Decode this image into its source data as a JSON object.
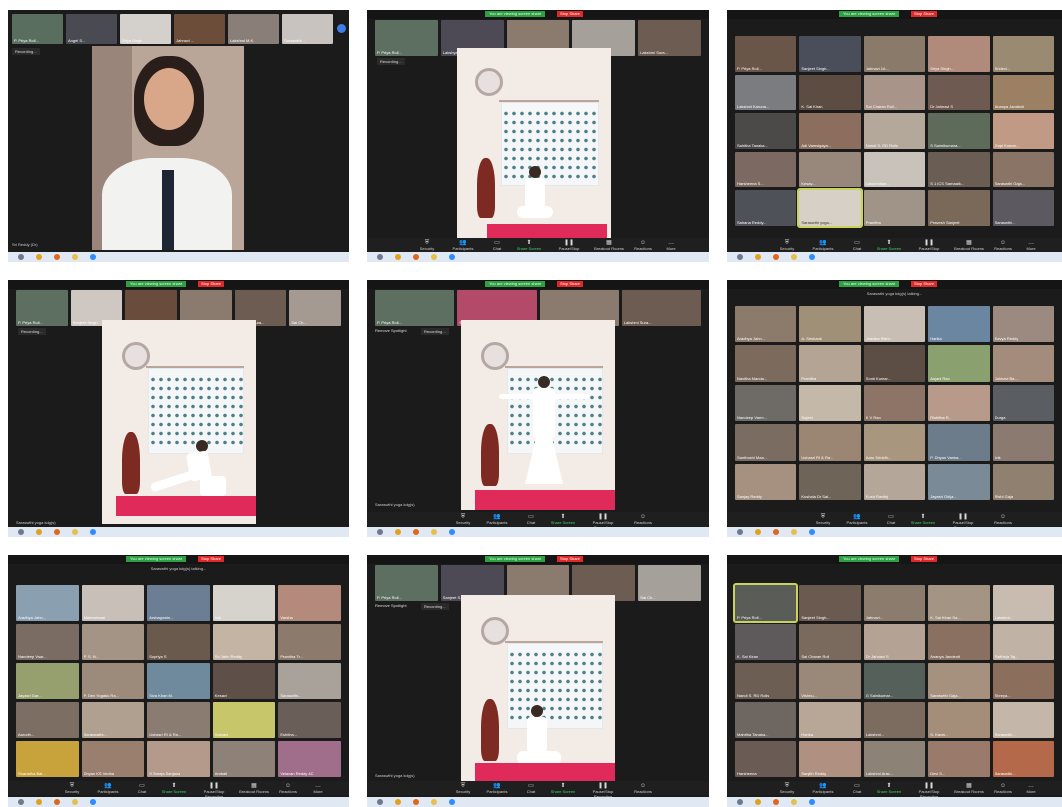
{
  "sharebar": {
    "notice": "You are viewing screen share",
    "stop_label": "Stop Share"
  },
  "recording_label": "Recording...",
  "remove_spotlight_label": "Remove Spotlight",
  "speaker_label": "Saraswthi yoga kdg(s)",
  "talking_label": "Saraswthi yoga kdg(s) talking...",
  "toolbar": {
    "security": "Security",
    "participants": "Participants",
    "chat": "Chat",
    "share_screen": "Share Screen",
    "record": "Pause/Stop Recording",
    "breakout": "Breakout Rooms",
    "reactions": "Reactions",
    "more": "More"
  },
  "p1": {
    "strip_names": [
      "P. Priya Roll...",
      "Angel S...",
      "Sriya Singh",
      "Jahnavi ...",
      "Lakshmi M.K.",
      "Saraswthi ..."
    ],
    "bottom_name": "Sri Reddy (Dr)"
  },
  "p2": {
    "strip_names": [
      "P. Priya Roll...",
      "Lakshya",
      "Jahnavi G...",
      "Sriya Sura...",
      "Lakshmi Sura..."
    ]
  },
  "p3": {
    "tiles": [
      "P. Priya Roll...",
      "Sanjeet Singh...",
      "Jahnavi 1A...",
      "Sriya Singh...",
      "Sridevi...",
      "Lakshmi Karuna...",
      "K. Sai Kiran",
      "Sai Charan Roll...",
      "Dr Jahnavi S",
      "Ananya Jandeoti",
      "Sahitha Tanaka...",
      "Adi Vamsigaya...",
      "Nandi S. RD Rolls",
      "S Saimikumara...",
      "Gopi Kumar...",
      "Harsheena S...",
      "Kesav...",
      "Lakshmikar...",
      "S 1 ICS Sarnaaik...",
      "Saraswthi Gaja...",
      "Sahana Reddy...",
      "Saraswthi yoga...",
      "Pranitha",
      "Pravesh Sanjeet",
      "Saraswthi..."
    ]
  },
  "p4": {
    "strip_names": [
      "P. Priya Roll...",
      "Sanjeet Singh",
      "Jahnavi",
      "Sai Ranjani Dy...",
      "Lakshmi Sura...",
      "Sai Ch..."
    ]
  },
  "p5": {
    "strip_names": [
      "P. Priya Roll...",
      "Sanjeet...",
      "Jahnavi GR...",
      "Lakshmi Sura..."
    ]
  },
  "p6": {
    "tiles": [
      "Aradhya Jahn...",
      "A. Seshank",
      "Jnanika Rishi...",
      "Harika",
      "Kavya Reddy",
      "Navitha Manda...",
      "Pranitha",
      "Sonti Kumar...",
      "Anjani Rao",
      "Jahnavi Ba...",
      "Nandeep Varm...",
      "Sujeet",
      "K V Rao",
      "Rishitha R..",
      "Durga",
      "Santhoshi Maa...",
      "Ushasri RI & Ra...",
      "Aaru Srinidh...",
      "P. Dhyan Vanka...",
      "Ivik",
      "Sanjay Reddy",
      "Kushala Dr Sai...",
      "Kush Ravitej",
      "Jayasri Girija...",
      "Rishi Gaja"
    ]
  },
  "p7": {
    "tiles": [
      "Aradhya Jahn...",
      "Maheshwari",
      "Arshagowin...",
      "Ivik",
      "Varsha",
      "Nandeep Vsar...",
      "P. S. N...",
      "Supriya S",
      "Sri Jahn Reddy",
      "Pranitha Tr...",
      "Jayasri Gar...",
      "P. Dev Yogaku Ra...",
      "Siva Kiran M.",
      "Kesavi",
      "Saraswthi...",
      "Aarudh...",
      "Saraswathi...",
      "Ushasri RI & Ra...",
      "Sarvani",
      "Eshitha...",
      "Sharadha Bal...",
      "Dhyan KS Vedha",
      "S Sreeja Sanjana",
      "Ambati",
      "Velavan Reddy 4C"
    ]
  },
  "p8": {
    "strip_names": [
      "P. Priya Roll...",
      "Sanjeet S...",
      "Jahnavi ...",
      "Lakshmi Surya...",
      "Sai Ch..."
    ]
  },
  "p9": {
    "tiles": [
      "P. Priya Roll...",
      "Sanjeet Singh...",
      "Jahnavi...",
      "K. Sai Kiran Sa...",
      "Lakshmi...",
      "K. Sai Kiran",
      "Sai Charan Roll",
      "Dr Jahnavi S",
      "Ananya Jandeoti",
      "Saitheja Taj...",
      "Nandi S. RD Rolls",
      "Vishnu...",
      "G Sainikumar...",
      "Saraswthi Gaja...",
      "Shreya...",
      "Mahitha Tanaka...",
      "Harika",
      "Lakshmi...",
      "S. Kavin...",
      "Saraswthi...",
      "Harsheena",
      "Sanjith Reddy",
      "Lakshmi Arav...",
      "Devi S...",
      "Saraswthi..."
    ]
  }
}
